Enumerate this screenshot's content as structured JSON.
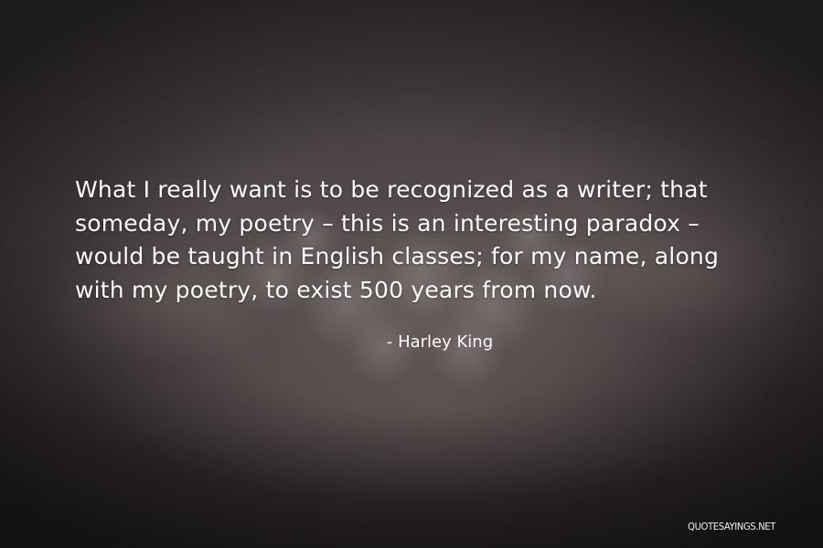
{
  "quote": {
    "text": "What I really want is to be recognized as a writer; that someday, my poetry  –  this is an interesting paradox  –  would be taught in English classes; for my name, along with my poetry, to exist 500 years from now.",
    "author": "- Harley King"
  },
  "watermark": "QUOTESAYINGS.NET",
  "colors": {
    "background": "#3f3939",
    "text": "#ffffff"
  }
}
